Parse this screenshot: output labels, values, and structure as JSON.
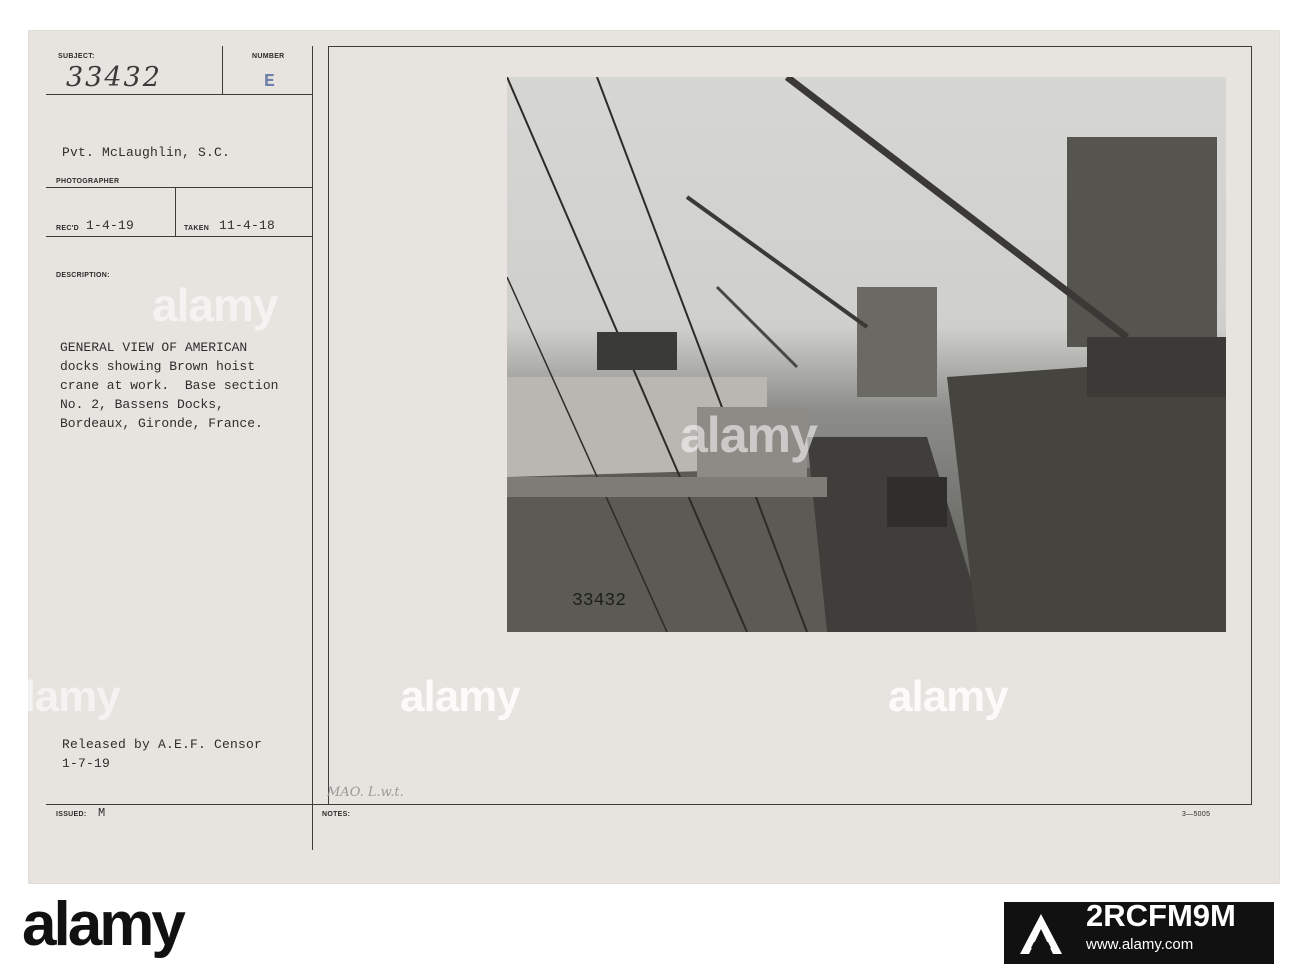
{
  "card": {
    "subject_label": "SUBJECT:",
    "number_label": "NUMBER",
    "subject_number": "33432",
    "number_letter": "E",
    "photographer_name": "Pvt. McLaughlin, S.C.",
    "photographer_label": "PHOTOGRAPHER",
    "recd_label": "REC'D",
    "recd_date": "1-4-19",
    "taken_label": "TAKEN",
    "taken_date": "11-4-18",
    "description_label": "DESCRIPTION:",
    "description_lines": [
      "GENERAL VIEW OF AMERICAN",
      "docks showing Brown hoist",
      "crane at work.  Base section",
      "No. 2, Bassens Docks,",
      "Bordeaux, Gironde, France."
    ],
    "released_line1": "Released by A.E.F. Censor",
    "released_line2": "1-7-19",
    "issued_label": "ISSUED:",
    "issued_value": "M",
    "notes_label": "NOTES:",
    "notes_handwriting": "MAO. L.w.t.",
    "form_code": "3—5005",
    "photo_stamp_number": "33432"
  },
  "watermarks": [
    "alamy",
    "alamy",
    "alamy",
    "alamy",
    "alamy"
  ],
  "footer": {
    "brand": "alamy",
    "image_id": "2RCFM9M",
    "url": "www.alamy.com"
  },
  "colors": {
    "card_bg": "#e7e4df",
    "ink": "#2e2e2e",
    "footer_box": "#111111"
  }
}
